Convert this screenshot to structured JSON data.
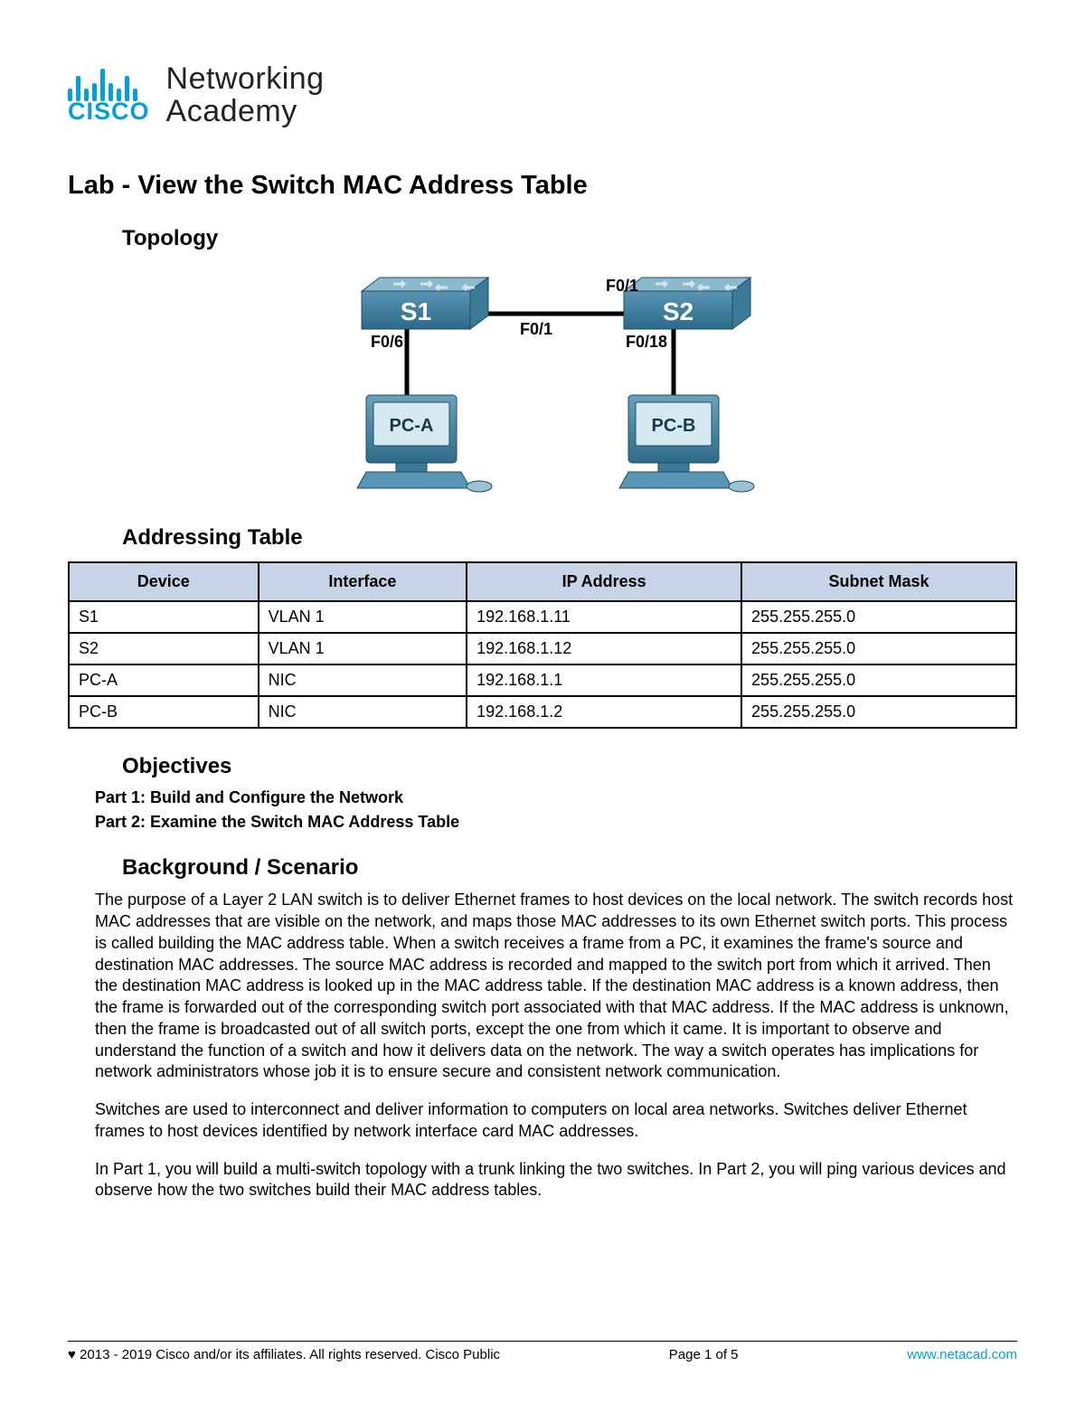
{
  "logo": {
    "line1": "Networking",
    "line2": "Academy",
    "brand": "CISCO"
  },
  "title": "Lab - View the Switch MAC Address Table",
  "sections": {
    "topology": "Topology",
    "addressing": "Addressing Table",
    "objectives": "Objectives",
    "background": "Background / Scenario"
  },
  "topology": {
    "s1": "S1",
    "s2": "S2",
    "pca": "PC-A",
    "pcb": "PC-B",
    "p_f06": "F0/6",
    "p_f01a": "F0/1",
    "p_f01b": "F0/1",
    "p_f018": "F0/18"
  },
  "table": {
    "headers": {
      "device": "Device",
      "interface": "Interface",
      "ip": "IP Address",
      "mask": "Subnet Mask"
    },
    "rows": [
      {
        "device": "S1",
        "interface": "VLAN 1",
        "ip": "192.168.1.11",
        "mask": "255.255.255.0"
      },
      {
        "device": "S2",
        "interface": "VLAN 1",
        "ip": "192.168.1.12",
        "mask": "255.255.255.0"
      },
      {
        "device": "PC-A",
        "interface": "NIC",
        "ip": "192.168.1.1",
        "mask": "255.255.255.0"
      },
      {
        "device": "PC-B",
        "interface": "NIC",
        "ip": "192.168.1.2",
        "mask": "255.255.255.0"
      }
    ]
  },
  "objectives": {
    "part1": "Part 1: Build and Configure the Network",
    "part2": "Part 2: Examine the Switch MAC Address Table"
  },
  "background": {
    "p1": "The purpose of a Layer 2 LAN switch is to deliver Ethernet frames to host devices on the local network. The switch records host MAC addresses that are visible on the network, and maps those MAC addresses to its own Ethernet switch ports. This process is called building the MAC address table. When a switch receives a frame from a PC, it examines the frame's source and destination MAC addresses. The source MAC address is recorded and mapped to the switch port from which it arrived. Then the destination MAC address is looked up in the MAC address table. If the destination MAC address is a known address, then the frame is forwarded out of the corresponding switch port associated with that MAC address. If the MAC address is unknown, then the frame is broadcasted out of all switch ports, except the one from which it came. It is important to observe and understand the function of a switch and how it delivers data on the network. The way a switch operates has implications for network administrators whose job it is to ensure secure and consistent network communication.",
    "p2": "Switches are used to interconnect and deliver information to computers on local area networks. Switches deliver Ethernet frames to host devices identified by network interface card MAC addresses.",
    "p3": "In Part 1, you will build a multi-switch topology with a trunk linking the two switches. In Part 2, you will ping various devices and observe how the two switches build their MAC address tables."
  },
  "footer": {
    "copyright": "♥ 2013 - 2019 Cisco and/or its affiliates. All rights reserved. Cisco Public",
    "page": "Page 1 of 5",
    "link": "www.netacad.com"
  }
}
